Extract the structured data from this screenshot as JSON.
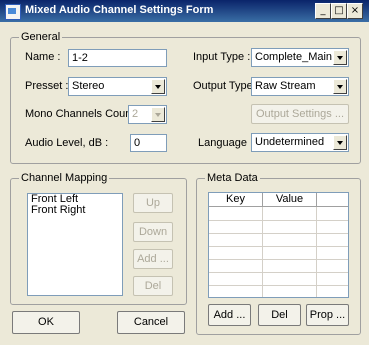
{
  "window": {
    "title": "Mixed Audio Channel Settings Form",
    "minimize": "_",
    "maximize": "□",
    "close": "×"
  },
  "general": {
    "legend": "General",
    "name_label": "Name :",
    "name_value": "1-2",
    "presset_label": "Presset :",
    "presset_value": "Stereo",
    "mono_label": "Mono Channels Count :",
    "mono_value": "2",
    "audio_label": "Audio Level, dB :",
    "audio_value": "0",
    "input_type_label": "Input Type :",
    "input_type_value": "Complete_Main",
    "output_type_label": "Output Type:",
    "output_type_value": "Raw Stream",
    "output_settings_label": "Output Settings ...",
    "language_label": "Language :",
    "language_value": "Undetermined"
  },
  "channel_mapping": {
    "legend": "Channel Mapping",
    "items": [
      "Front Left",
      "Front Right"
    ],
    "up": "Up",
    "down": "Down",
    "add": "Add ...",
    "del": "Del"
  },
  "meta_data": {
    "legend": "Meta Data",
    "col_key": "Key",
    "col_value": "Value",
    "add": "Add ...",
    "del": "Del",
    "prop": "Prop ..."
  },
  "footer": {
    "ok": "OK",
    "cancel": "Cancel"
  }
}
